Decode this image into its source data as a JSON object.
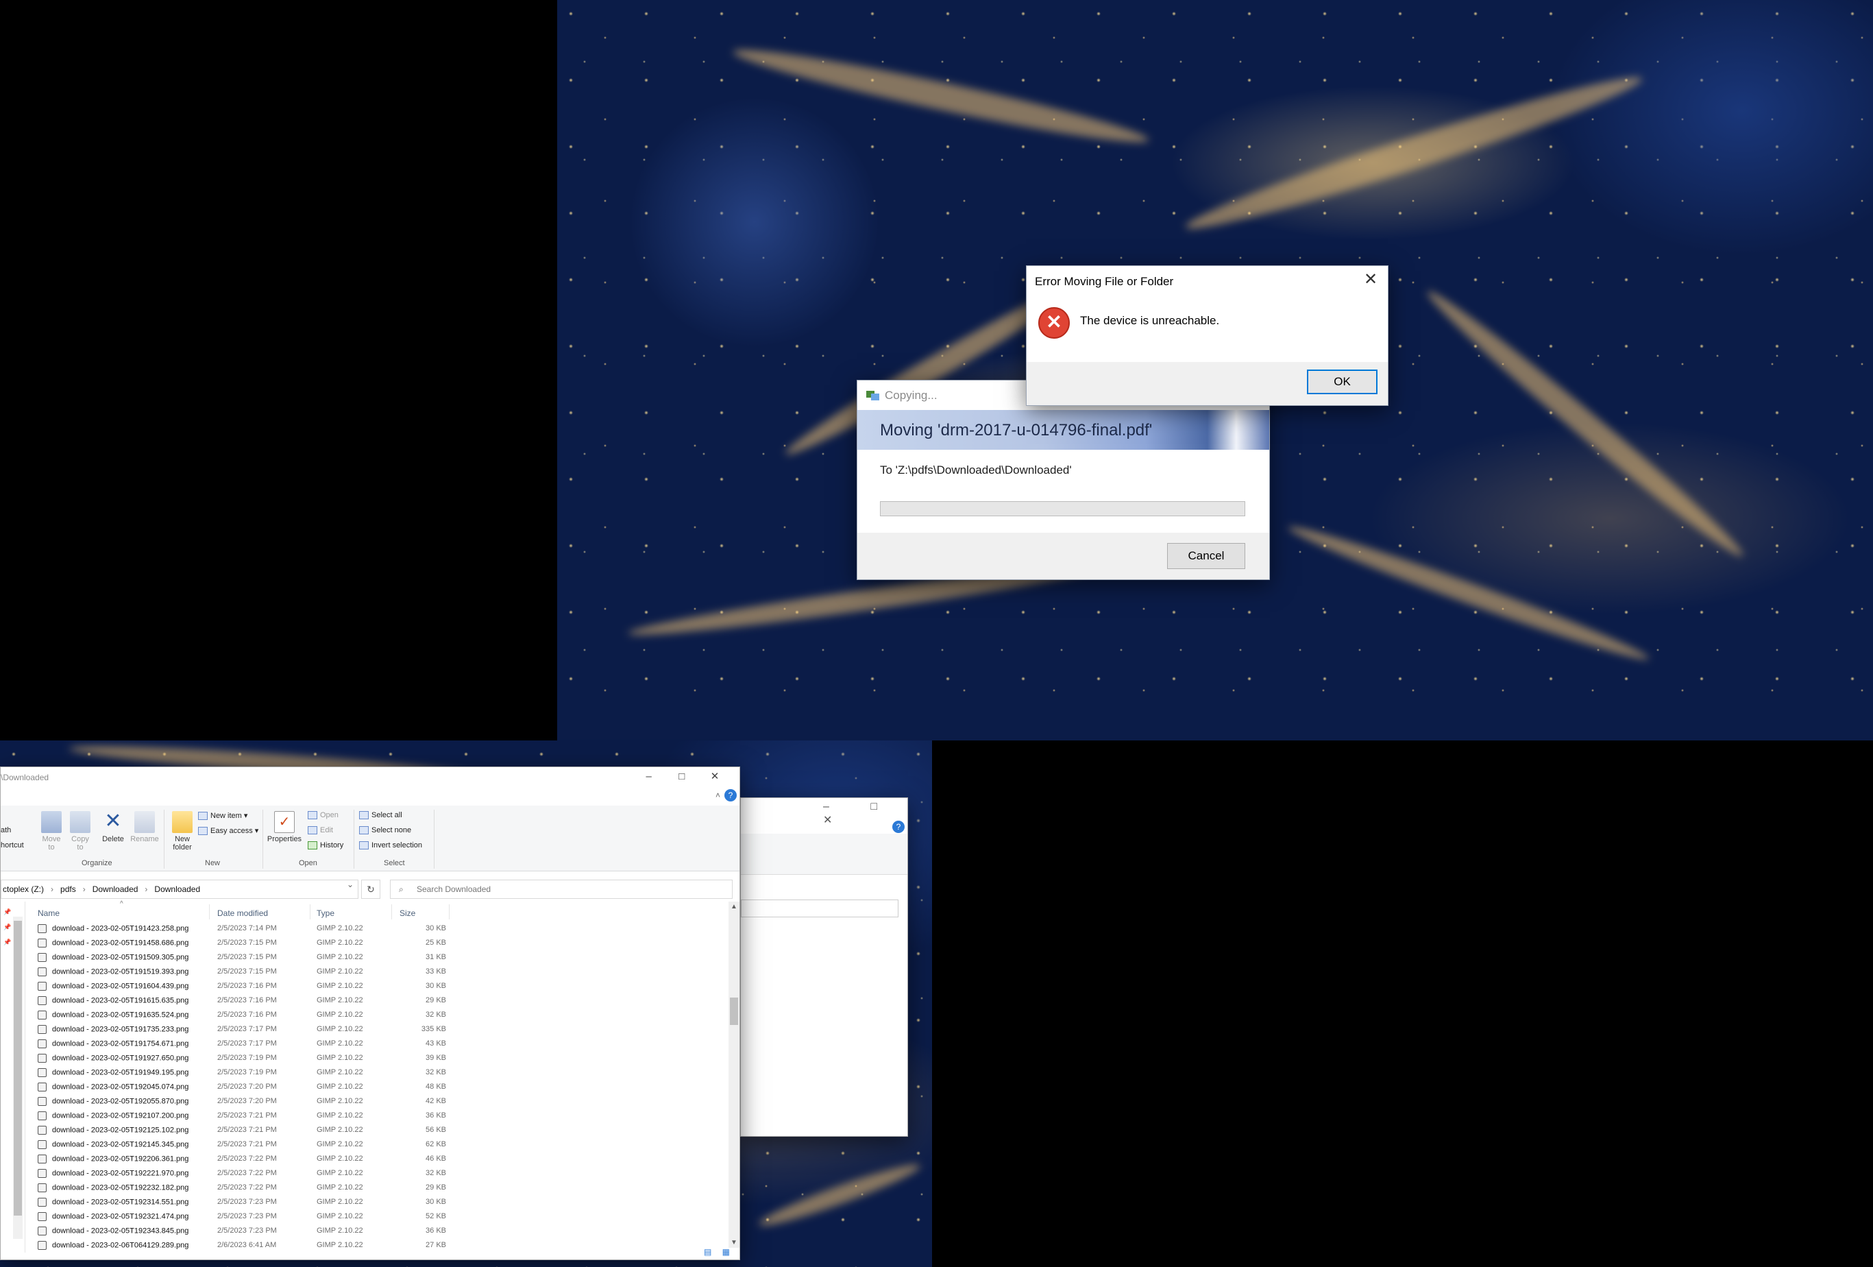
{
  "error_dialog": {
    "title": "Error Moving File or Folder",
    "message": "The device is unreachable.",
    "ok_label": "OK",
    "close_glyph": "✕",
    "icon": "error-x-icon",
    "icon_glyph": "✕"
  },
  "copy_dialog": {
    "title": "Copying...",
    "heading": "Moving 'drm-2017-u-014796-final.pdf'",
    "destination": "To 'Z:\\pdfs\\Downloaded\\Downloaded'",
    "progress_percent": 0,
    "cancel_label": "Cancel"
  },
  "explorer_back": {
    "window_controls": "– □ ✕",
    "help_glyph": "?"
  },
  "explorer": {
    "title": "\\Downloaded",
    "window_controls": [
      "–",
      "□",
      "✕"
    ],
    "ribbon": {
      "organize": {
        "path_label": "ath",
        "shortcut_label": "hortcut",
        "move_to": "Move to",
        "copy_to": "Copy to",
        "delete": "Delete",
        "rename": "Rename",
        "group": "Organize"
      },
      "new": {
        "new_folder": "New folder",
        "new_item": "New item",
        "easy_access": "Easy access",
        "group": "New"
      },
      "open": {
        "properties": "Properties",
        "open": "Open",
        "edit": "Edit",
        "history": "History",
        "group": "Open"
      },
      "select": {
        "select_all": "Select all",
        "select_none": "Select none",
        "invert_selection": "Invert selection",
        "group": "Select"
      },
      "collapse_glyph": "˄",
      "help_glyph": "?"
    },
    "address": {
      "segments": [
        "ctoplex (Z:)",
        "pdfs",
        "Downloaded",
        "Downloaded"
      ],
      "chevron": "›",
      "dropdown_glyph": "⌄",
      "refresh_glyph": "↻"
    },
    "search": {
      "placeholder": "Search Downloaded",
      "icon_glyph": "⌕"
    },
    "columns": {
      "name": "Name",
      "date": "Date modified",
      "type": "Type",
      "size": "Size",
      "sort_glyph": "^"
    },
    "files": [
      {
        "name": "download - 2023-02-05T191423.258.png",
        "date": "2/5/2023 7:14 PM",
        "type": "GIMP 2.10.22",
        "size": "30 KB"
      },
      {
        "name": "download - 2023-02-05T191458.686.png",
        "date": "2/5/2023 7:15 PM",
        "type": "GIMP 2.10.22",
        "size": "25 KB"
      },
      {
        "name": "download - 2023-02-05T191509.305.png",
        "date": "2/5/2023 7:15 PM",
        "type": "GIMP 2.10.22",
        "size": "31 KB"
      },
      {
        "name": "download - 2023-02-05T191519.393.png",
        "date": "2/5/2023 7:15 PM",
        "type": "GIMP 2.10.22",
        "size": "33 KB"
      },
      {
        "name": "download - 2023-02-05T191604.439.png",
        "date": "2/5/2023 7:16 PM",
        "type": "GIMP 2.10.22",
        "size": "30 KB"
      },
      {
        "name": "download - 2023-02-05T191615.635.png",
        "date": "2/5/2023 7:16 PM",
        "type": "GIMP 2.10.22",
        "size": "29 KB"
      },
      {
        "name": "download - 2023-02-05T191635.524.png",
        "date": "2/5/2023 7:16 PM",
        "type": "GIMP 2.10.22",
        "size": "32 KB"
      },
      {
        "name": "download - 2023-02-05T191735.233.png",
        "date": "2/5/2023 7:17 PM",
        "type": "GIMP 2.10.22",
        "size": "335 KB"
      },
      {
        "name": "download - 2023-02-05T191754.671.png",
        "date": "2/5/2023 7:17 PM",
        "type": "GIMP 2.10.22",
        "size": "43 KB"
      },
      {
        "name": "download - 2023-02-05T191927.650.png",
        "date": "2/5/2023 7:19 PM",
        "type": "GIMP 2.10.22",
        "size": "39 KB"
      },
      {
        "name": "download - 2023-02-05T191949.195.png",
        "date": "2/5/2023 7:19 PM",
        "type": "GIMP 2.10.22",
        "size": "32 KB"
      },
      {
        "name": "download - 2023-02-05T192045.074.png",
        "date": "2/5/2023 7:20 PM",
        "type": "GIMP 2.10.22",
        "size": "48 KB"
      },
      {
        "name": "download - 2023-02-05T192055.870.png",
        "date": "2/5/2023 7:20 PM",
        "type": "GIMP 2.10.22",
        "size": "42 KB"
      },
      {
        "name": "download - 2023-02-05T192107.200.png",
        "date": "2/5/2023 7:21 PM",
        "type": "GIMP 2.10.22",
        "size": "36 KB"
      },
      {
        "name": "download - 2023-02-05T192125.102.png",
        "date": "2/5/2023 7:21 PM",
        "type": "GIMP 2.10.22",
        "size": "56 KB"
      },
      {
        "name": "download - 2023-02-05T192145.345.png",
        "date": "2/5/2023 7:21 PM",
        "type": "GIMP 2.10.22",
        "size": "62 KB"
      },
      {
        "name": "download - 2023-02-05T192206.361.png",
        "date": "2/5/2023 7:22 PM",
        "type": "GIMP 2.10.22",
        "size": "46 KB"
      },
      {
        "name": "download - 2023-02-05T192221.970.png",
        "date": "2/5/2023 7:22 PM",
        "type": "GIMP 2.10.22",
        "size": "32 KB"
      },
      {
        "name": "download - 2023-02-05T192232.182.png",
        "date": "2/5/2023 7:22 PM",
        "type": "GIMP 2.10.22",
        "size": "29 KB"
      },
      {
        "name": "download - 2023-02-05T192314.551.png",
        "date": "2/5/2023 7:23 PM",
        "type": "GIMP 2.10.22",
        "size": "30 KB"
      },
      {
        "name": "download - 2023-02-05T192321.474.png",
        "date": "2/5/2023 7:23 PM",
        "type": "GIMP 2.10.22",
        "size": "52 KB"
      },
      {
        "name": "download - 2023-02-05T192343.845.png",
        "date": "2/5/2023 7:23 PM",
        "type": "GIMP 2.10.22",
        "size": "36 KB"
      },
      {
        "name": "download - 2023-02-06T064129.289.png",
        "date": "2/6/2023 6:41 AM",
        "type": "GIMP 2.10.22",
        "size": "27 KB"
      }
    ],
    "status_glyphs": "▤ ▦"
  },
  "colors": {
    "accent": "#0078d7",
    "error": "#e04434",
    "progress": "#06b025",
    "wallpaper_base": "#0b1c48"
  }
}
